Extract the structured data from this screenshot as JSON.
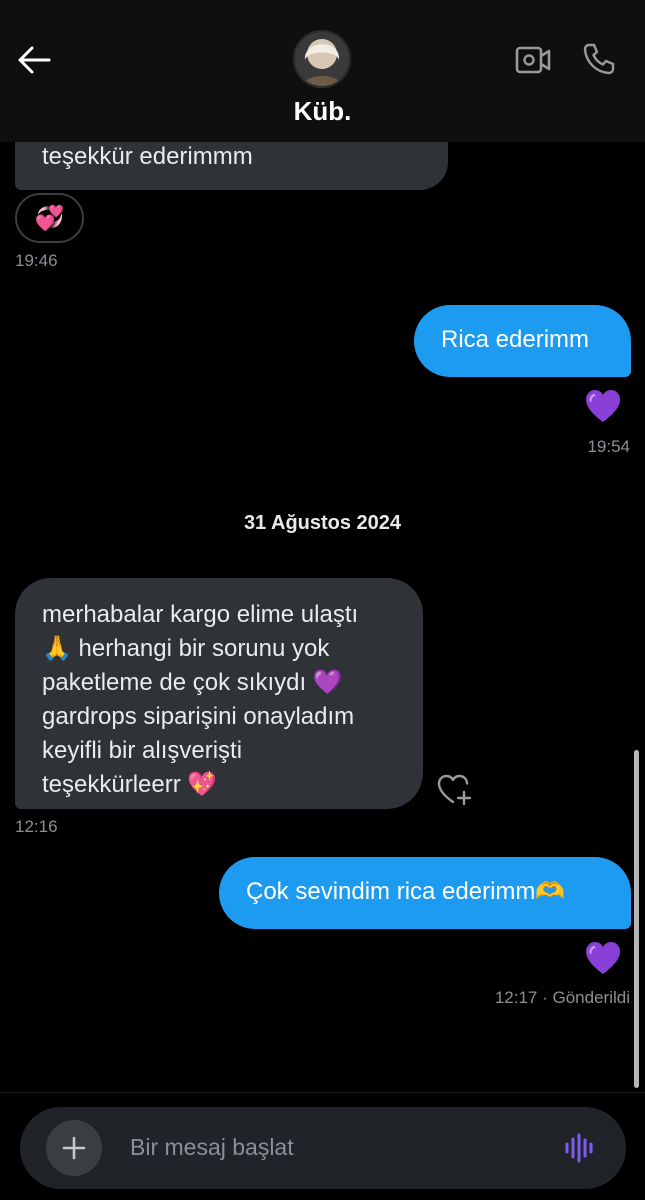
{
  "header": {
    "title": "Küb.",
    "icons": {
      "back": "arrow-left-icon",
      "video": "video-camera-icon",
      "call": "phone-icon"
    }
  },
  "messages": [
    {
      "id": "m1",
      "direction": "incoming",
      "text": "teşekkür ederimmm",
      "reaction": "💞",
      "time": "19:46"
    },
    {
      "id": "m2",
      "direction": "outgoing",
      "text": "Rica ederimm",
      "reaction": "💜",
      "time": "19:54"
    },
    {
      "id": "m3",
      "direction": "incoming",
      "lines": [
        "merhabalar kargo elime ulaştı",
        "🙏 herhangi bir sorunu yok",
        "paketleme de çok sıkıydı 💜",
        "gardrops siparişini onayladım",
        "keyifli bir alışverişti",
        "teşekkürleerr 💖"
      ],
      "time": "12:16"
    },
    {
      "id": "m4",
      "direction": "outgoing",
      "text": "Çok sevindim rica ederimm🫶",
      "reaction": "💜",
      "time": "12:17",
      "status": "· Gönderildi"
    }
  ],
  "date_separator": "31 Ağustos 2024",
  "composer": {
    "placeholder": "Bir mesaj başlat",
    "add_icon": "plus-icon",
    "voice_icon": "voice-wave-icon"
  },
  "colors": {
    "outgoing": "#1d9bf0",
    "incoming": "#2f3236",
    "background": "#000000",
    "voice_accent": "#7c5cf0"
  }
}
